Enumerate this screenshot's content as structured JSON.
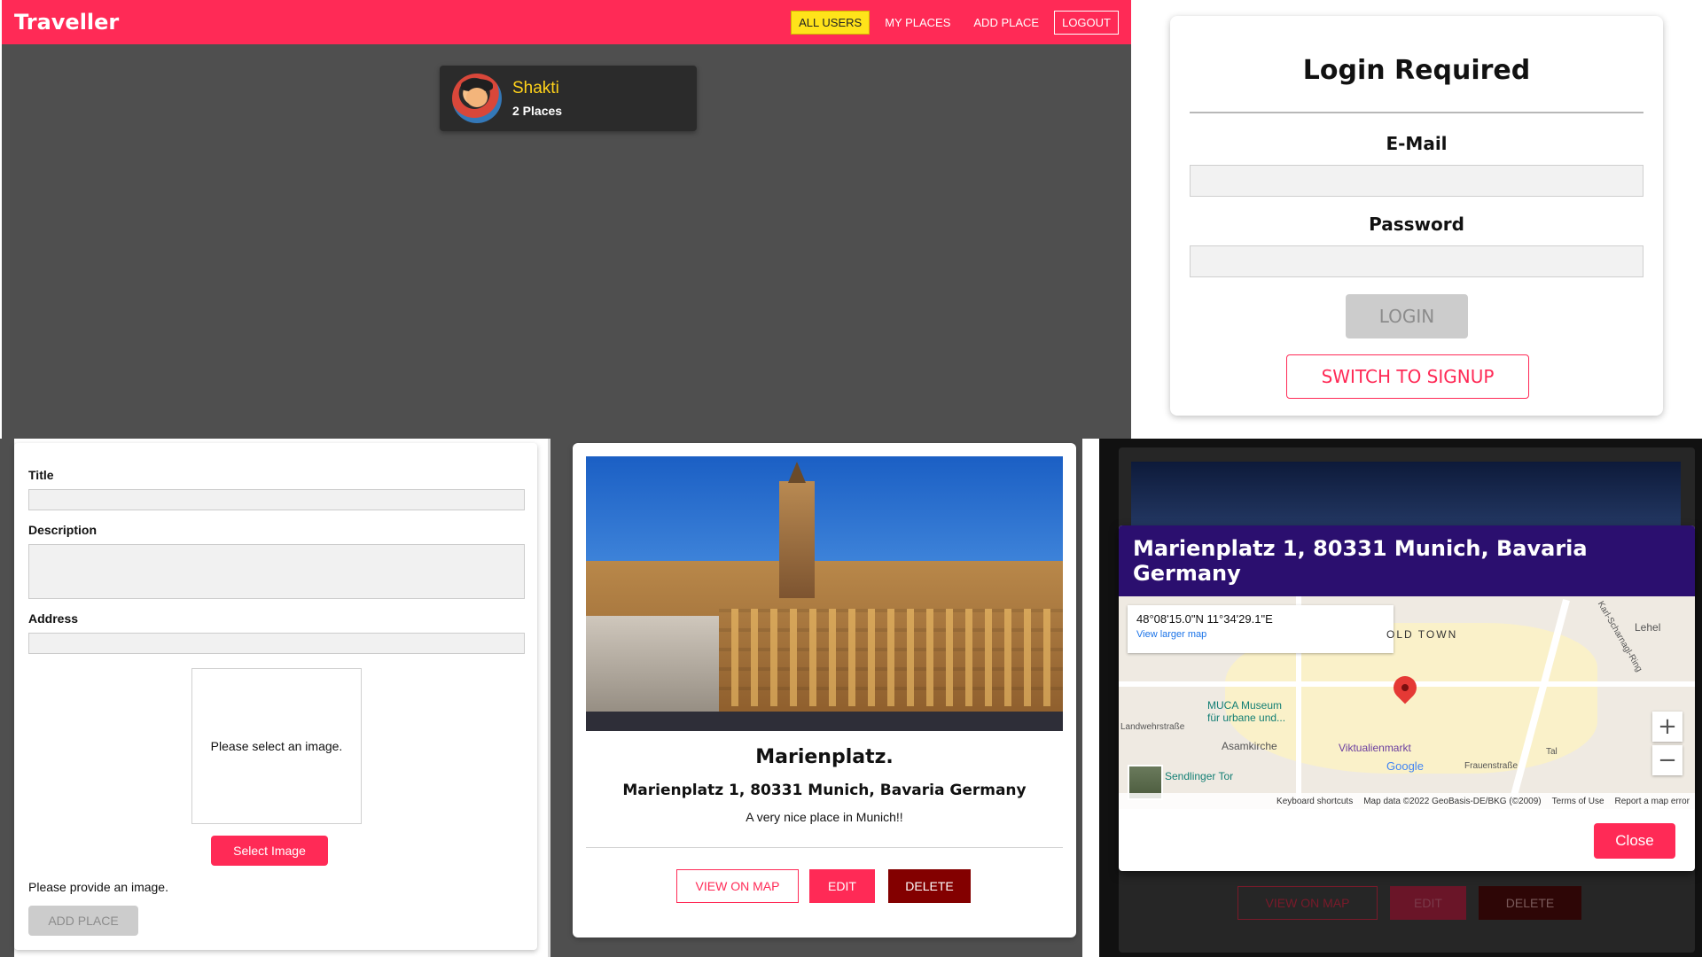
{
  "navbar": {
    "brand": "Traveller",
    "links": [
      "ALL USERS",
      "MY PLACES",
      "ADD PLACE",
      "LOGOUT"
    ]
  },
  "user_card": {
    "name": "Shakti",
    "places": "2 Places"
  },
  "login": {
    "title": "Login Required",
    "email_label": "E-Mail",
    "password_label": "Password",
    "login_button": "LOGIN",
    "switch_button": "SWITCH TO SIGNUP"
  },
  "form": {
    "title_label": "Title",
    "description_label": "Description",
    "address_label": "Address",
    "image_placeholder": "Please select an image.",
    "select_image_button": "Select Image",
    "message": "Please provide an image.",
    "add_place_button": "ADD PLACE"
  },
  "place_card": {
    "title": "Marienplatz.",
    "address": "Marienplatz 1, 80331 Munich, Bavaria Germany",
    "description": "A very nice place in Munich!!",
    "buttons": [
      "VIEW ON MAP",
      "EDIT",
      "DELETE"
    ]
  },
  "map_modal": {
    "header": "Marienplatz 1, 80331 Munich, Bavaria Germany",
    "coords": "48°08'15.0\"N 11°34'29.1\"E",
    "view_larger": "View larger map",
    "labels": [
      "OLD TOWN",
      "MUCA Museum",
      "für urbane und...",
      "Asamkirche",
      "Viktualienmarkt",
      "Sendlinger Tor",
      "Lehel",
      "Landwehrstraße",
      "Tal",
      "Frauenstraße",
      "Karl-Scharnagl-Ring",
      "Google"
    ],
    "footer": [
      "Keyboard shortcuts",
      "Map data ©2022 GeoBasis-DE/BKG (©2009)",
      "Terms of Use",
      "Report a map error"
    ],
    "zoom_in": "+",
    "zoom_out": "−",
    "close_button": "Close"
  },
  "background_buttons": [
    "VIEW ON MAP",
    "EDIT",
    "DELETE"
  ],
  "colors": {
    "primary": "#ff2a56",
    "nav_active": "#ffe31a",
    "modal_header": "#2b0f6f",
    "delete": "#830000",
    "page_bg": "#4f4f4f"
  }
}
